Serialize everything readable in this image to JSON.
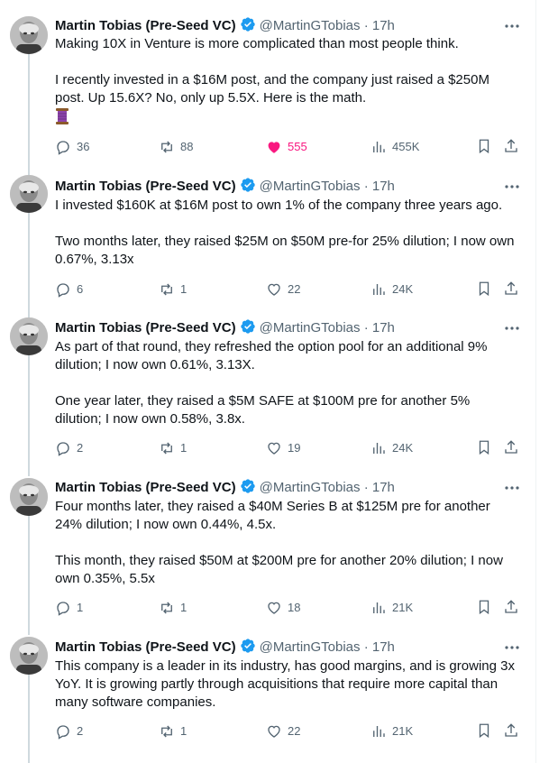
{
  "author": {
    "name": "Martin Tobias (Pre-Seed VC)",
    "handle": "@MartinGTobias",
    "separator": "·"
  },
  "colors": {
    "text": "#0f1419",
    "muted": "#536471",
    "verified": "#1d9bf0",
    "like": "#f91880",
    "thread_line": "#cfd9de"
  },
  "icons": {
    "reply": "speech-bubble-icon",
    "retweet": "retweet-arrows-icon",
    "like": "heart-icon",
    "views": "bar-chart-icon",
    "bookmark": "bookmark-icon",
    "share": "share-upload-icon",
    "more": "more-dots-icon",
    "verified": "verified-badge-icon",
    "thread": "spool-of-thread-emoji"
  },
  "tweets": [
    {
      "time": "17h",
      "paragraphs": [
        "Making 10X in Venture is more complicated than most people think.",
        "I recently invested in a $16M post, and the company just raised a $250M post. Up 15.6X? No, only up 5.5X. Here is the math."
      ],
      "emoji": "🧵",
      "replies": "36",
      "retweets": "88",
      "likes": "555",
      "liked": true,
      "views": "455K"
    },
    {
      "time": "17h",
      "paragraphs": [
        "I invested $160K at $16M post to own 1% of the company three years ago.",
        "Two months later, they raised $25M on $50M pre-for 25% dilution; I now own 0.67%, 3.13x"
      ],
      "replies": "6",
      "retweets": "1",
      "likes": "22",
      "liked": false,
      "views": "24K"
    },
    {
      "time": "17h",
      "paragraphs": [
        "As part of that round, they refreshed the option pool for an additional 9% dilution; I now own 0.61%, 3.13X.",
        "One year later, they raised a $5M SAFE at $100M pre for another 5% dilution; I now own 0.58%, 3.8x."
      ],
      "replies": "2",
      "retweets": "1",
      "likes": "19",
      "liked": false,
      "views": "24K"
    },
    {
      "time": "17h",
      "paragraphs": [
        "Four months later, they raised a $40M Series B at $125M pre for another 24% dilution; I now own 0.44%, 4.5x.",
        "This month, they raised $50M at $200M pre for another 20% dilution; I now own 0.35%, 5.5x"
      ],
      "replies": "1",
      "retweets": "1",
      "likes": "18",
      "liked": false,
      "views": "21K"
    },
    {
      "time": "17h",
      "paragraphs": [
        "This company is a leader in its industry, has good margins, and is growing 3x YoY. It is growing partly through acquisitions that require more capital than many software companies."
      ],
      "replies": "2",
      "retweets": "1",
      "likes": "22",
      "liked": false,
      "views": "21K"
    }
  ]
}
